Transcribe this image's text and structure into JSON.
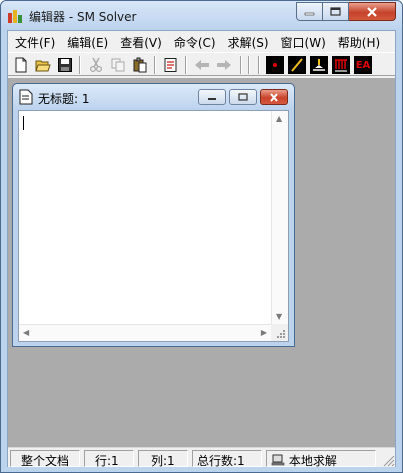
{
  "window": {
    "title": "编辑器 - SM Solver",
    "icons": {
      "app": "app-logo-icon",
      "minimize": "minimize-icon",
      "maximize": "maximize-icon",
      "close": "close-icon"
    }
  },
  "menu": [
    {
      "label": "文件(F)"
    },
    {
      "label": "编辑(E)"
    },
    {
      "label": "查看(V)"
    },
    {
      "label": "命令(C)"
    },
    {
      "label": "求解(S)"
    },
    {
      "label": "窗口(W)"
    },
    {
      "label": "帮助(H)"
    }
  ],
  "toolbar": {
    "buttons": [
      {
        "name": "new-file",
        "icon": "new-document-icon",
        "enabled": true
      },
      {
        "name": "open-file",
        "icon": "open-folder-icon",
        "enabled": true
      },
      {
        "name": "save-file",
        "icon": "save-disk-icon",
        "enabled": true
      },
      {
        "name": "cut",
        "icon": "scissors-icon",
        "enabled": false
      },
      {
        "name": "copy",
        "icon": "copy-icon",
        "enabled": false
      },
      {
        "name": "paste",
        "icon": "paste-icon",
        "enabled": true
      },
      {
        "name": "run-script",
        "icon": "script-icon",
        "enabled": true
      },
      {
        "name": "back",
        "icon": "arrow-left-icon",
        "enabled": false
      },
      {
        "name": "forward",
        "icon": "arrow-right-icon",
        "enabled": false
      },
      {
        "name": "tool-node",
        "icon": "node-icon",
        "enabled": true
      },
      {
        "name": "tool-line",
        "icon": "line-icon",
        "enabled": true
      },
      {
        "name": "tool-support",
        "icon": "support-icon",
        "enabled": true
      },
      {
        "name": "tool-load",
        "icon": "distributed-load-icon",
        "enabled": true
      },
      {
        "name": "tool-ea",
        "icon": "ea-icon",
        "label": "EA",
        "enabled": true
      }
    ]
  },
  "child_window": {
    "title": "无标题: 1",
    "editor_content": ""
  },
  "status": {
    "scope": "整个文档",
    "row": "行:1",
    "col": "列:1",
    "total_lines": "总行数:1",
    "mode": "本地求解"
  },
  "colors": {
    "frame": "#bcd3ee",
    "mdi_background": "#ababab",
    "close_red": "#c6432b",
    "toolbar_red": "#e00000"
  }
}
